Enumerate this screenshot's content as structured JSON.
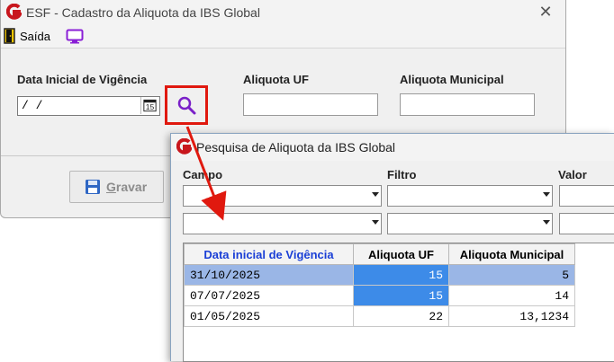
{
  "main_window": {
    "title": "ESF - Cadastro da Aliquota da IBS Global",
    "close_glyph": "✕",
    "toolbar": {
      "exit_label": "Saída",
      "exit_icon": "door-exit-icon",
      "monitor_icon": "monitor-icon"
    },
    "form": {
      "date_label": "Data Inicial de Vigência",
      "date_value": " / /",
      "calendar_icon": "calendar-icon",
      "search_icon": "magnifier-icon",
      "uf_label": "Aliquota UF",
      "uf_value": "",
      "municipal_label": "Aliquota Municipal",
      "municipal_value": ""
    },
    "save_button": {
      "label_underlined": "G",
      "label_rest": "ravar",
      "icon": "floppy-disk-icon"
    }
  },
  "search_dialog": {
    "title": "Pesquisa de Aliquota da IBS Global",
    "filter_labels": {
      "campo": "Campo",
      "filtro": "Filtro",
      "valor": "Valor"
    },
    "columns": [
      "Data inicial de Vigência",
      "Aliquota UF",
      "Aliquota Municipal"
    ],
    "rows": [
      {
        "date": "31/10/2025",
        "uf": "15",
        "municipal": "5"
      },
      {
        "date": "07/07/2025",
        "uf": "15",
        "municipal": "14"
      },
      {
        "date": "01/05/2025",
        "uf": "22",
        "municipal": "13,1234"
      }
    ],
    "selected_row": 0
  },
  "colors": {
    "highlight_border": "#e0190f",
    "selected_row": "#9ab6e6",
    "focused_cell": "#3d8be8",
    "header_accent": "#1a3fd6"
  }
}
